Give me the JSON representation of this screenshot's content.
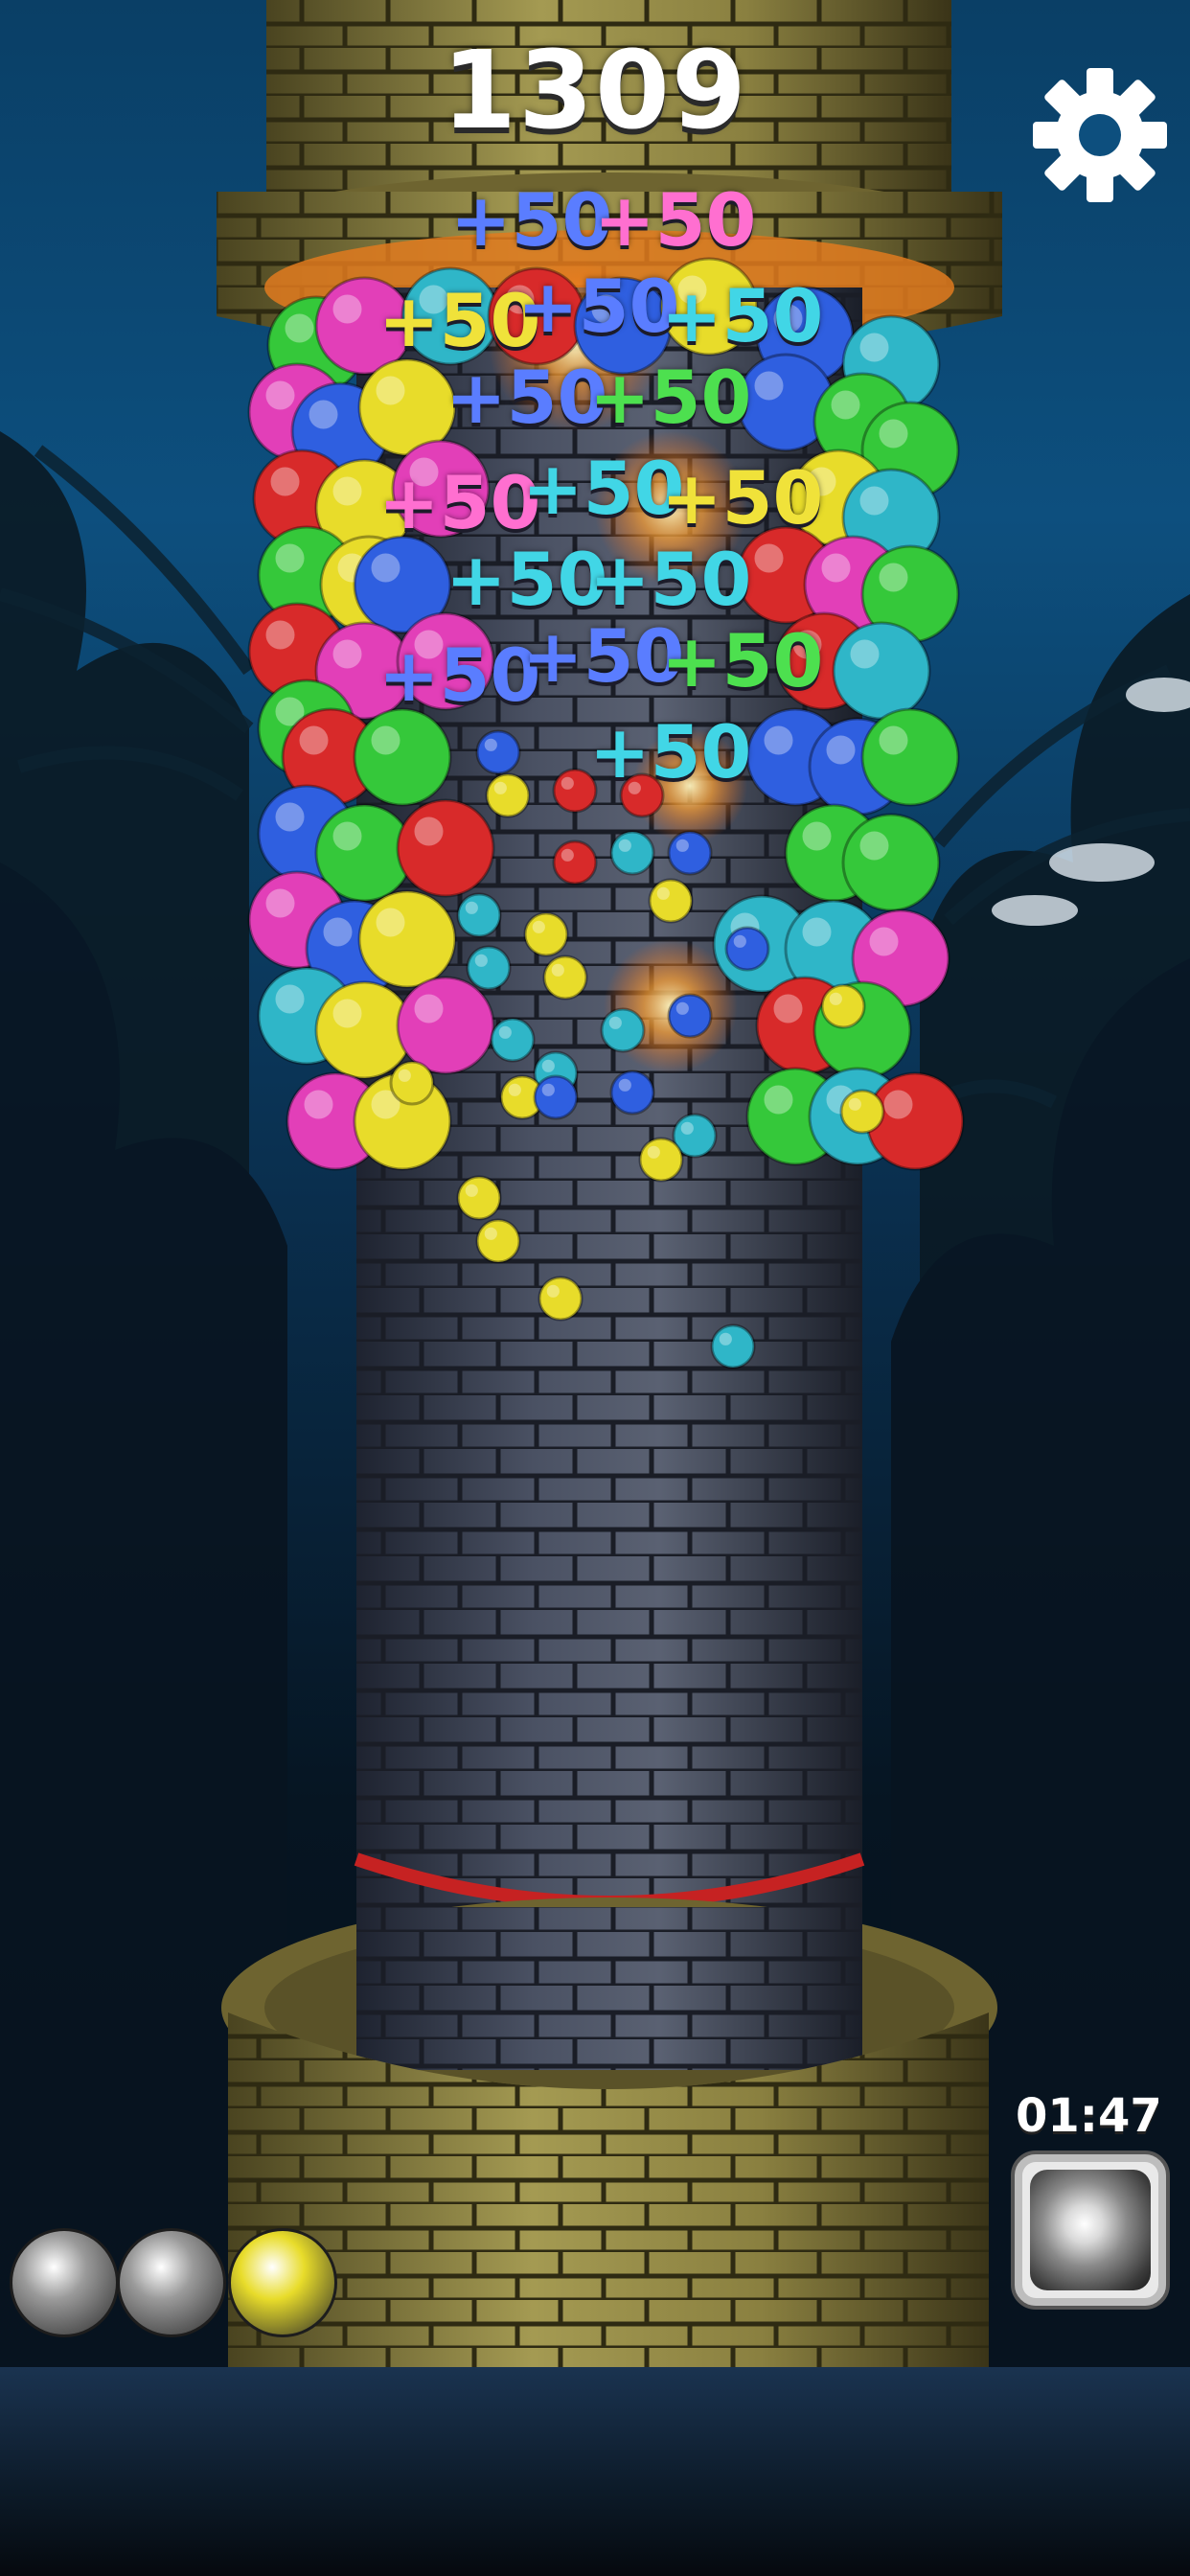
{
  "hud": {
    "score": "1309",
    "timer": "01:47"
  },
  "icons": {
    "settings": "gear-icon",
    "powerup": "fireball-icon"
  },
  "colors": {
    "green": "#35c83a",
    "magenta": "#e23fb8",
    "blue": "#2f5fe0",
    "yellow": "#e8dc2a",
    "red": "#d82a2a",
    "cyan": "#2fb6c8",
    "gray": "#9a9a9a"
  },
  "floating_scores": [
    {
      "text": "+50",
      "color": "#5a7dff"
    },
    {
      "text": "+50",
      "color": "#ff6fd0"
    },
    {
      "text": "+50",
      "color": "#f0e23a"
    },
    {
      "text": "+50",
      "color": "#5a7dff"
    },
    {
      "text": "+50",
      "color": "#41d6e6"
    },
    {
      "text": "+50",
      "color": "#5a7dff"
    },
    {
      "text": "+50",
      "color": "#4de04f"
    },
    {
      "text": "+50",
      "color": "#ff6fd0"
    },
    {
      "text": "+50",
      "color": "#41d6e6"
    },
    {
      "text": "+50",
      "color": "#f0e23a"
    },
    {
      "text": "+50",
      "color": "#41d6e6"
    },
    {
      "text": "+50",
      "color": "#41d6e6"
    },
    {
      "text": "+50",
      "color": "#5a7dff"
    },
    {
      "text": "+50",
      "color": "#5a7dff"
    },
    {
      "text": "+50",
      "color": "#4de04f"
    },
    {
      "text": "+50",
      "color": "#41d6e6"
    }
  ],
  "ball_queue": [
    "gray",
    "gray",
    "yellow"
  ]
}
